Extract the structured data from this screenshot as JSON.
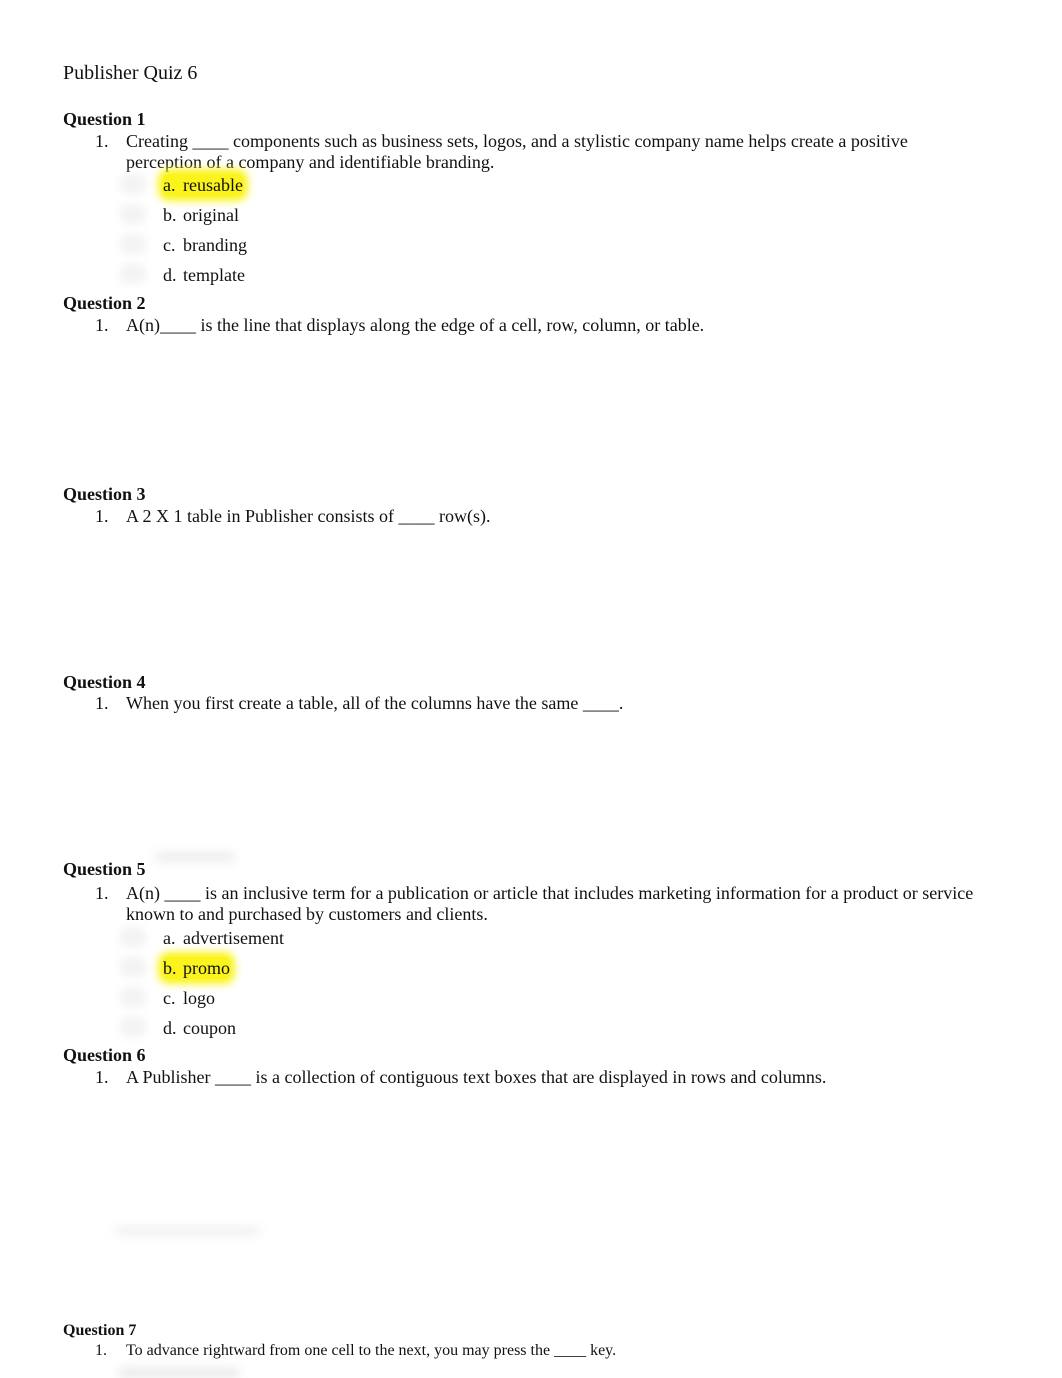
{
  "document": {
    "title": "Publisher Quiz 6"
  },
  "questions": [
    {
      "heading": "Question 1",
      "number": "1.",
      "text": "Creating ____ components such as business sets, logos, and a stylistic company name helps create a positive perception of a company and identifiable branding.",
      "options": [
        {
          "letter": "a.",
          "text": "reusable",
          "highlighted": true
        },
        {
          "letter": "b.",
          "text": "original",
          "highlighted": false
        },
        {
          "letter": "c.",
          "text": "branding",
          "highlighted": false
        },
        {
          "letter": "d.",
          "text": "template",
          "highlighted": false
        }
      ]
    },
    {
      "heading": "Question 2",
      "number": "1.",
      "text": "A(n)____ is the line that displays along the edge of a cell, row, column, or table."
    },
    {
      "heading": "Question 3",
      "number": "1.",
      "text": "A 2 X 1 table in Publisher consists of ____ row(s)."
    },
    {
      "heading": "Question 4",
      "number": "1.",
      "text": "When you first create a table, all of the columns have the same ____."
    },
    {
      "heading": "Question 5",
      "number": "1.",
      "text": "A(n) ____ is an inclusive term for a publication or article that includes marketing information for a product or service known to and purchased by customers and clients.",
      "options": [
        {
          "letter": "a.",
          "text": "advertisement",
          "highlighted": false
        },
        {
          "letter": "b.",
          "text": "promo",
          "highlighted": true
        },
        {
          "letter": "c.",
          "text": "logo",
          "highlighted": false
        },
        {
          "letter": "d.",
          "text": "coupon",
          "highlighted": false
        }
      ]
    },
    {
      "heading": "Question 6",
      "number": "1.",
      "text": "A Publisher ____ is a collection of contiguous text boxes that are displayed in rows and columns."
    },
    {
      "heading": "Question 7",
      "number": "1.",
      "text": "To advance rightward from one cell to the next, you may press the ____ key."
    }
  ],
  "colors": {
    "highlight": "#fbf41c",
    "text": "#111111",
    "background": "#ffffff"
  }
}
